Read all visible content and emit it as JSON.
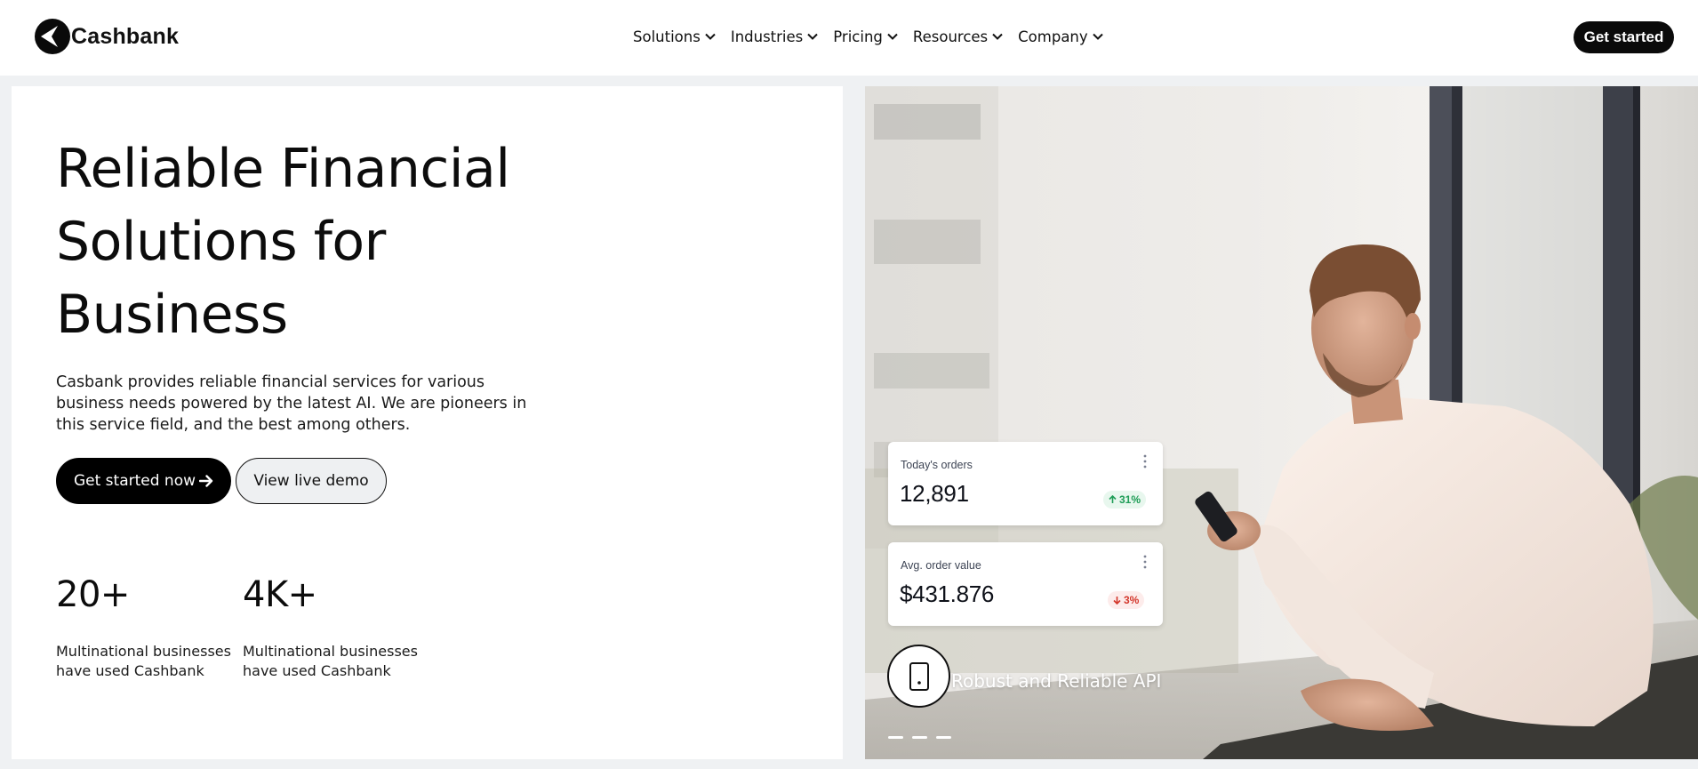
{
  "brand": {
    "name": "Cashbank"
  },
  "nav": {
    "items": [
      {
        "label": "Solutions"
      },
      {
        "label": "Industries"
      },
      {
        "label": "Pricing"
      },
      {
        "label": "Resources"
      },
      {
        "label": "Company"
      }
    ],
    "cta_label": "Get started"
  },
  "hero": {
    "title_lines": [
      "Reliable Financial",
      "Solutions for",
      "Business"
    ],
    "description": "Casbank provides reliable financial services for various business needs powered by the latest AI. We are pioneers in this service field, and the best among others.",
    "primary_button": "Get started now",
    "secondary_button": "View live demo"
  },
  "stats": [
    {
      "value": "20+",
      "label": "Multinational businesses have used Cashbank"
    },
    {
      "value": "4K+",
      "label": "Multinational businesses have used Cashbank"
    }
  ],
  "cards": [
    {
      "title": "Today's orders",
      "value": "12,891",
      "change": "31%",
      "direction": "up",
      "color": "#1f9d57"
    },
    {
      "title": "Avg. order value",
      "value": "$431.876",
      "change": "3%",
      "direction": "down",
      "color": "#d3362a"
    }
  ],
  "feature": {
    "label": "Robust and Reliable API",
    "icon": "tablet-icon"
  },
  "slider": {
    "dots": 3
  },
  "colors": {
    "primary": "#000000",
    "background": "#eff1f3"
  }
}
